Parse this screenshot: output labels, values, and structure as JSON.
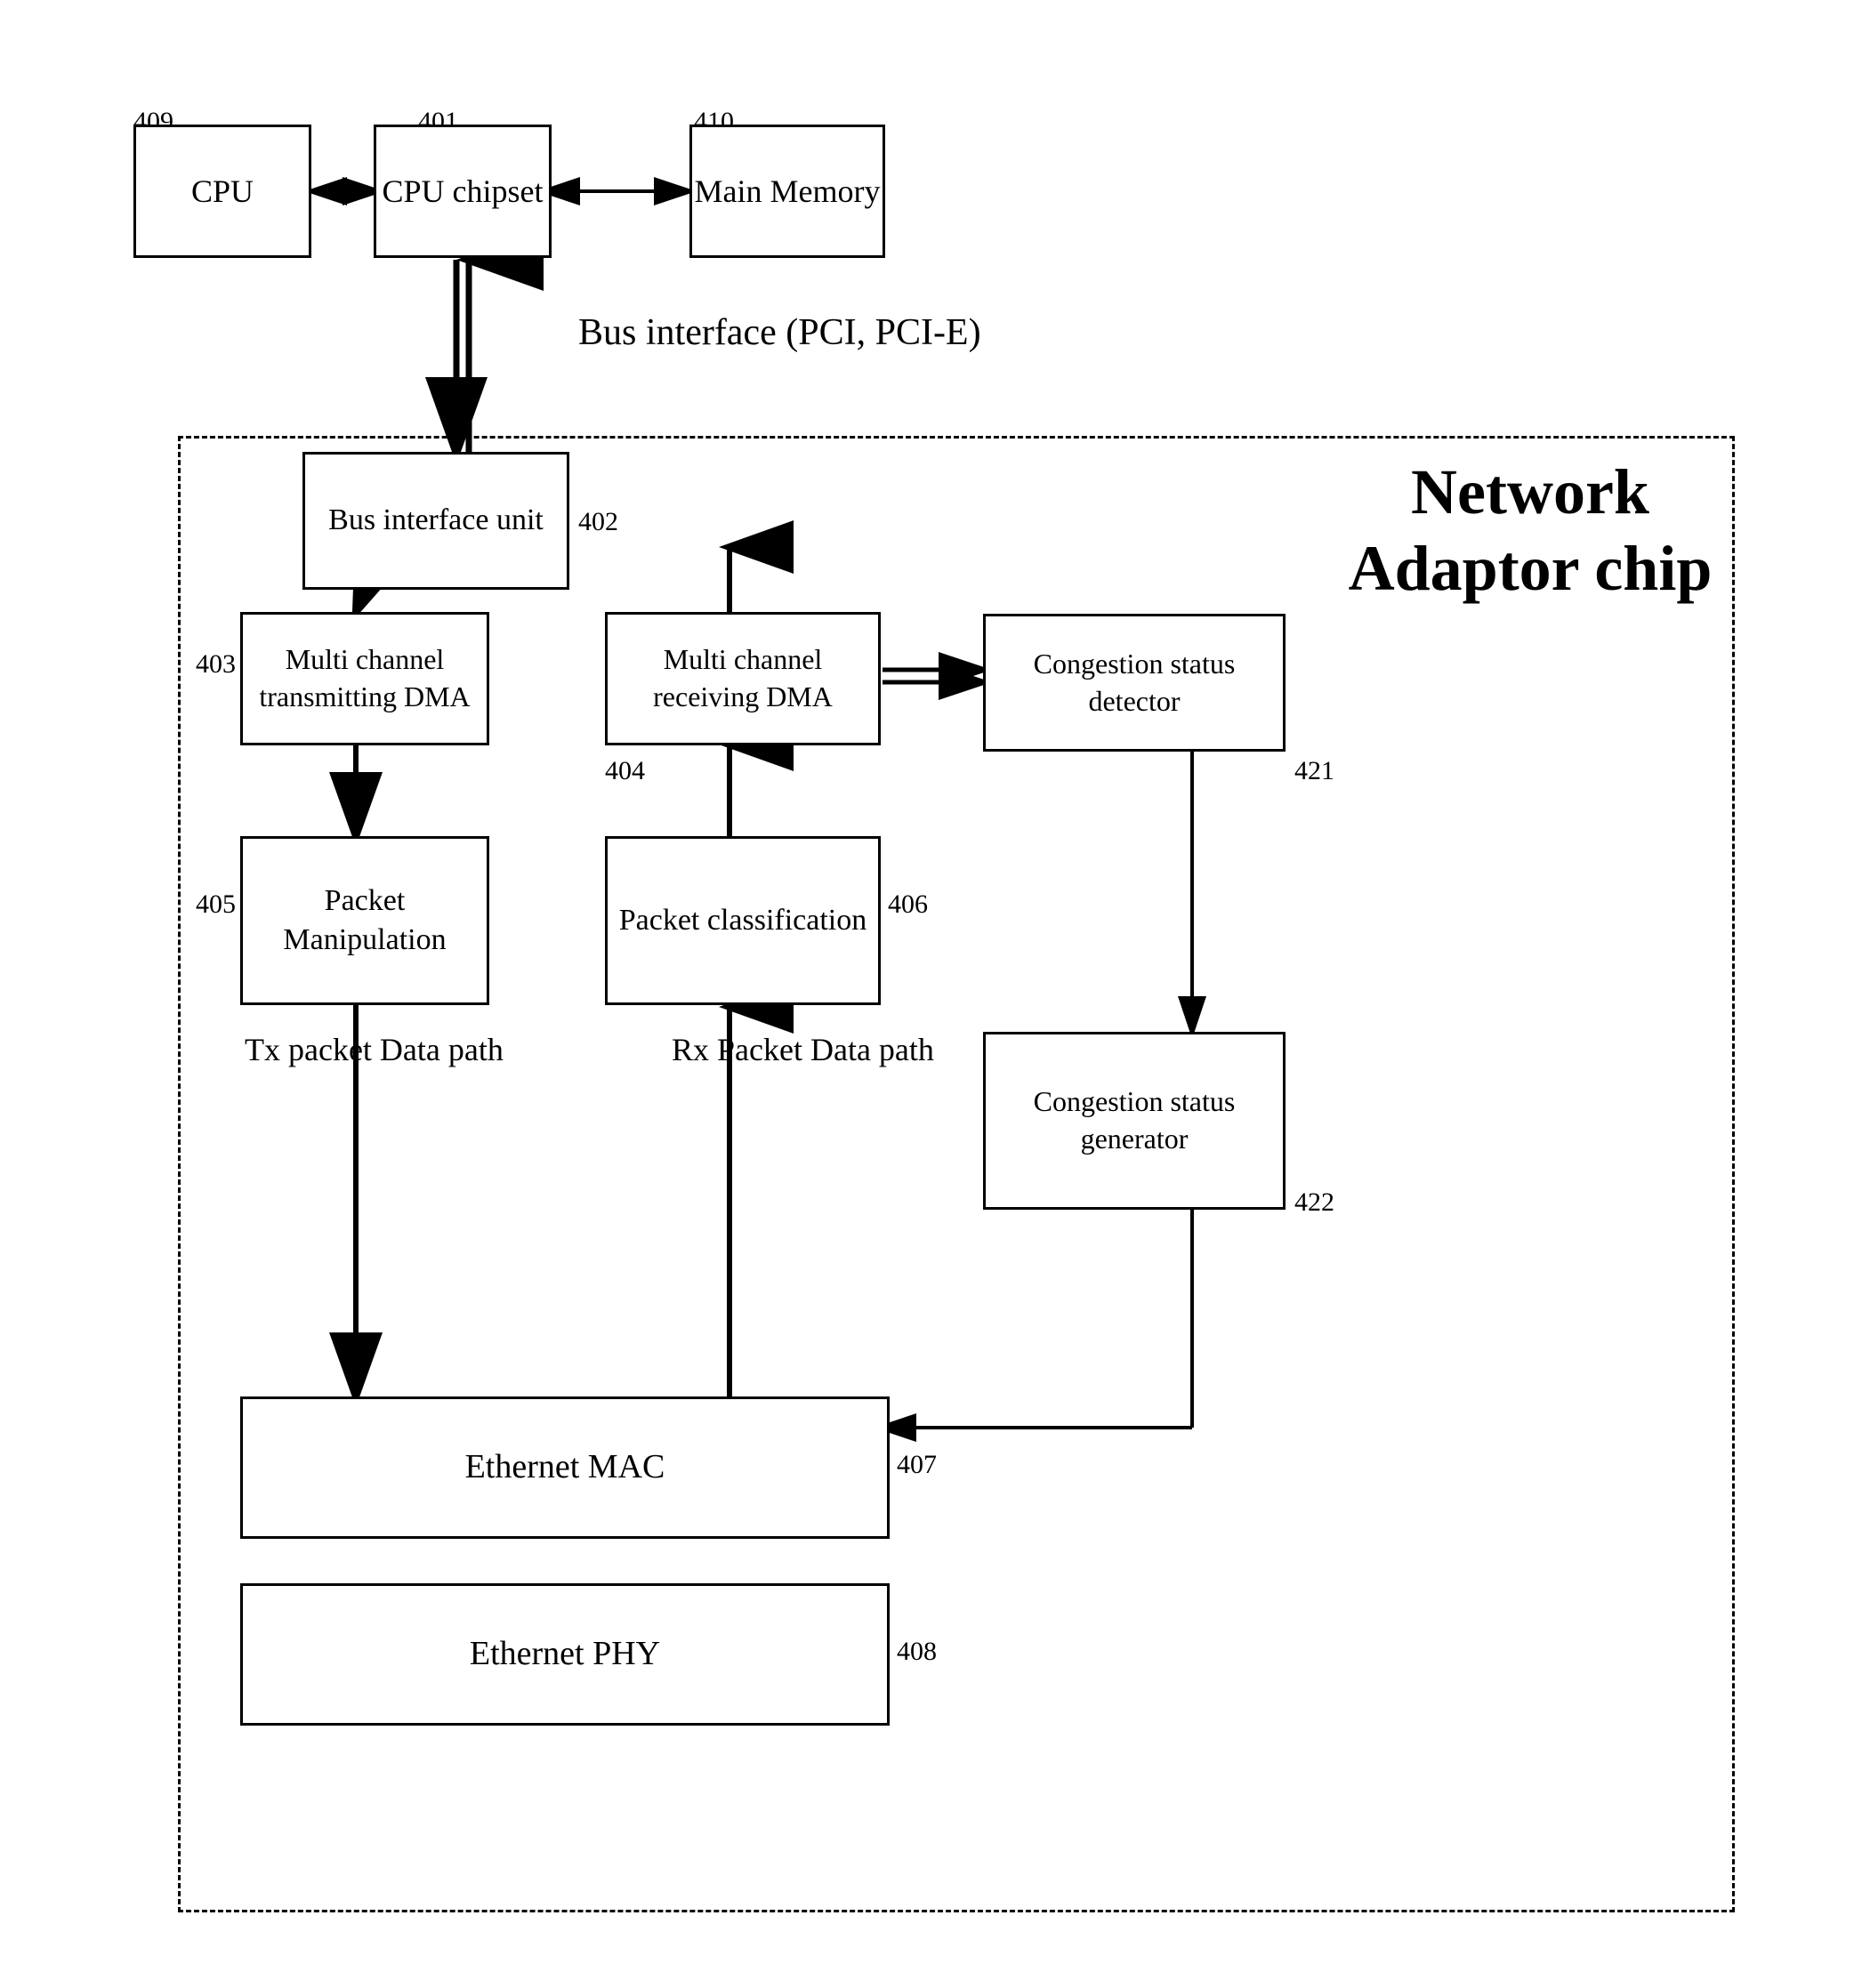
{
  "diagram": {
    "title": "Network\nAdaptor chip",
    "boxes": {
      "cpu": {
        "label": "CPU",
        "refnum": "409"
      },
      "cpu_chipset": {
        "label": "CPU\nchipset",
        "refnum": "401"
      },
      "main_memory": {
        "label": "Main Memory",
        "refnum": "410"
      },
      "bus_interface_unit": {
        "label": "Bus interface\nunit",
        "refnum": "402"
      },
      "multi_channel_tx": {
        "label": "Multi channel\ntransmitting DMA",
        "refnum": "403"
      },
      "multi_channel_rx": {
        "label": "Multi channel\nreceiving DMA",
        "refnum": "404"
      },
      "congestion_detector": {
        "label": "Congestion status\ndetector",
        "refnum": "421"
      },
      "packet_manipulation": {
        "label": "Packet\nManipulation",
        "refnum": "405"
      },
      "packet_classification": {
        "label": "Packet\nclassification",
        "refnum": "406"
      },
      "congestion_generator": {
        "label": "Congestion status\ngenerator",
        "refnum": "422"
      },
      "ethernet_mac": {
        "label": "Ethernet\nMAC",
        "refnum": "407"
      },
      "ethernet_phy": {
        "label": "Ethernet\nPHY",
        "refnum": "408"
      }
    },
    "labels": {
      "bus_interface": "Bus interface (PCI, PCI-E)",
      "tx_data_path": "Tx packet\nData path",
      "rx_data_path": "Rx Packet\nData path"
    }
  }
}
